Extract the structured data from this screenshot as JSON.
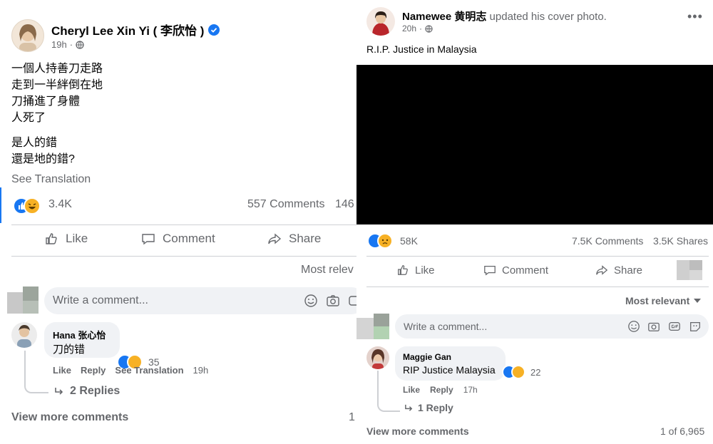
{
  "left_post": {
    "author": "Cheryl Lee Xin Yi ( 李欣怡 )",
    "time": "19h",
    "lines": [
      "一個人持善刀走路",
      "走到一半絆倒在地",
      "刀捅進了身體",
      "人死了",
      "是人的錯",
      "還是地的錯?"
    ],
    "see_translation": "See Translation",
    "reaction_count": "3.4K",
    "comments_count": "557 Comments",
    "shares_count": "146",
    "actions": {
      "like": "Like",
      "comment": "Comment",
      "share": "Share"
    },
    "sort_label": "Most relev",
    "comment_placeholder": "Write a comment...",
    "comment": {
      "author": "Hana 张心怡",
      "text": "刀的错",
      "reaction_count": "35",
      "like": "Like",
      "reply": "Reply",
      "see_translation": "See Translation",
      "time": "19h"
    },
    "replies": "2 Replies",
    "view_more": "View more comments",
    "page_counter": "1"
  },
  "right_post": {
    "author": "Namewee 黄明志",
    "action_text": "updated his cover photo.",
    "time": "20h",
    "caption": "R.I.P. Justice in Malaysia",
    "reaction_count": "58K",
    "comments_count": "7.5K Comments",
    "shares_count": "3.5K Shares",
    "actions": {
      "like": "Like",
      "comment": "Comment",
      "share": "Share"
    },
    "sort_label": "Most relevant",
    "comment_placeholder": "Write a comment...",
    "comment": {
      "author": "Maggie Gan",
      "text": "RIP Justice Malaysia",
      "reaction_count": "22",
      "like": "Like",
      "reply": "Reply",
      "time": "17h"
    },
    "replies": "1 Reply",
    "view_more": "View more comments",
    "page_counter": "1 of 6,965"
  },
  "colors": {
    "like_blue": "#1877f2",
    "emoji_yellow": "#f7b125",
    "verified": "#1877f2",
    "muted": "#65676b",
    "comment_bg": "#f0f2f5"
  }
}
